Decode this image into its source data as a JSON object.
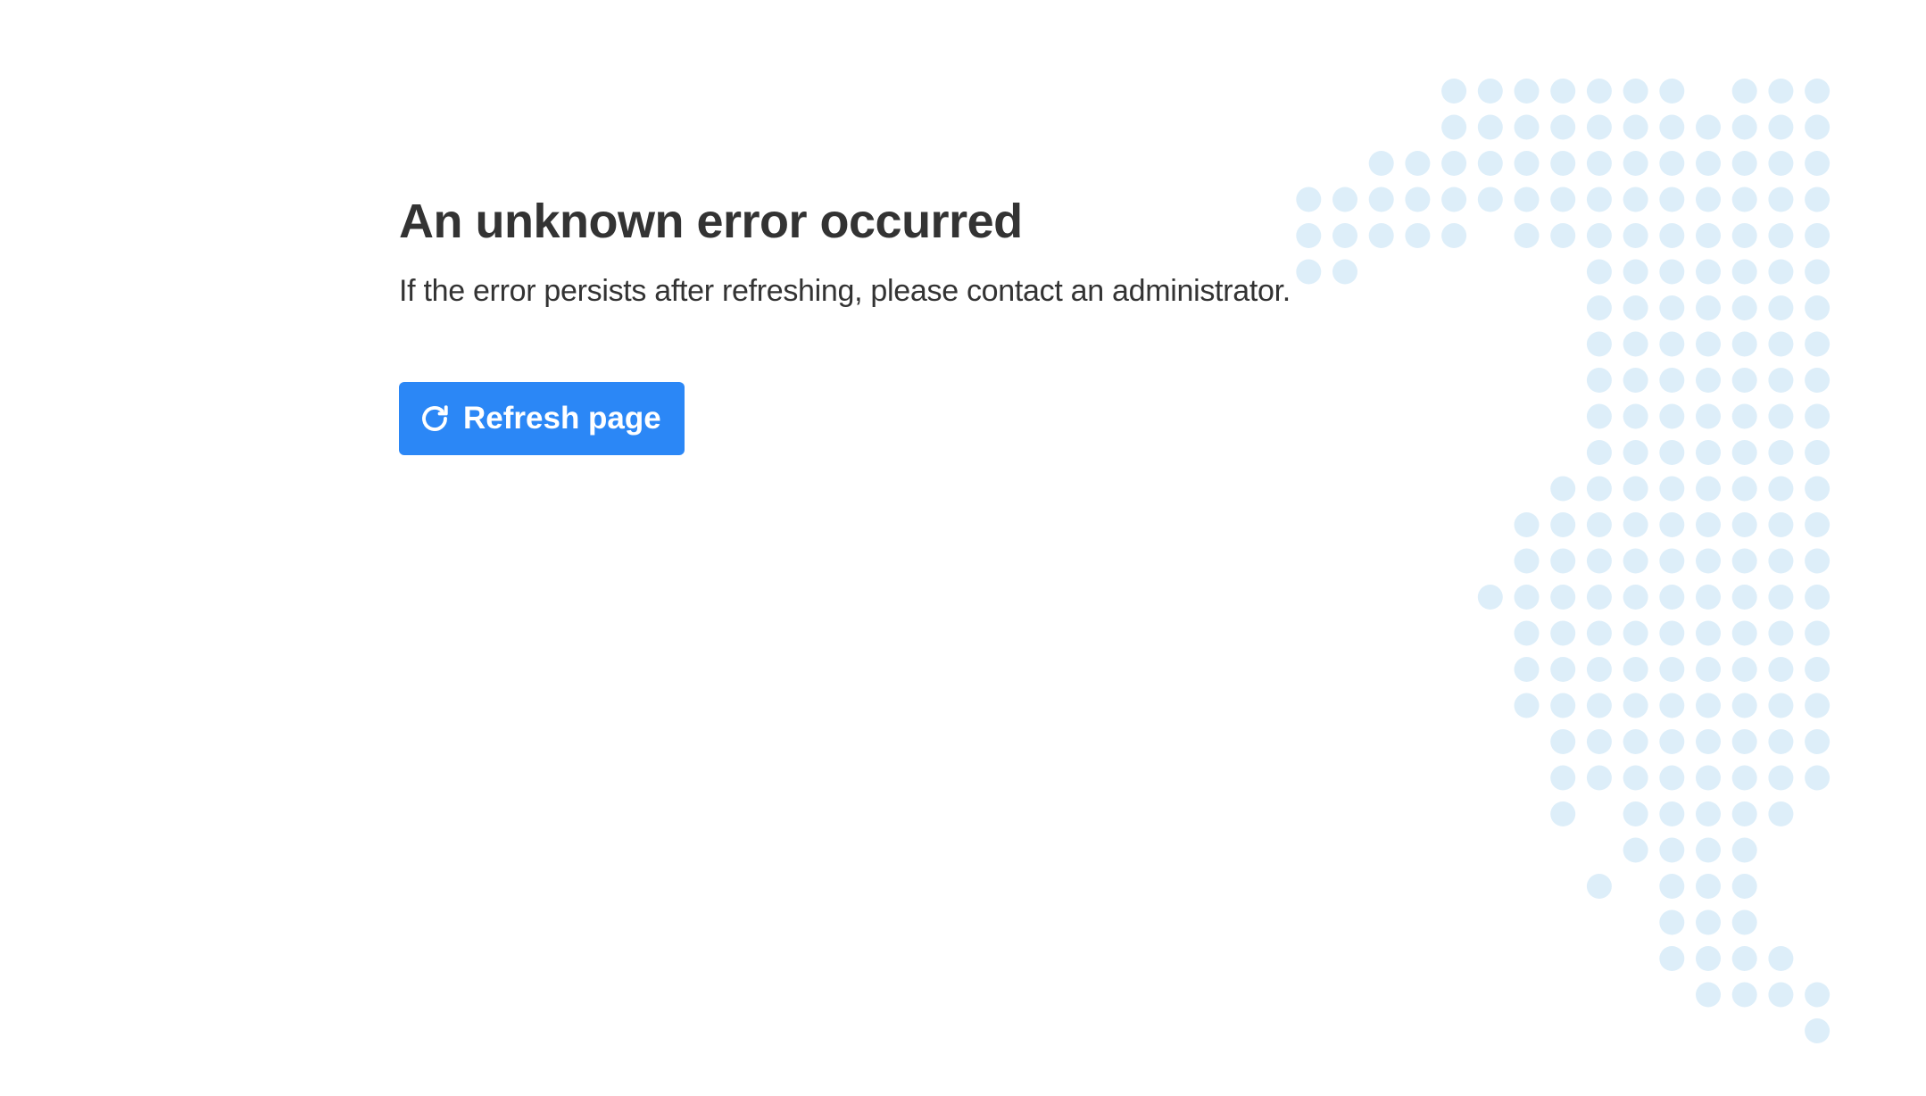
{
  "error": {
    "title": "An unknown error occurred",
    "message": "If the error persists after refreshing, please contact an administrator."
  },
  "actions": {
    "refresh_label": "Refresh page",
    "refresh_icon": "refresh-icon"
  },
  "theme": {
    "accent": "#2b87f6",
    "text": "#333333",
    "dot_color": "#ddeef9"
  },
  "decoration": {
    "icon": "dotted-map-graphic"
  }
}
